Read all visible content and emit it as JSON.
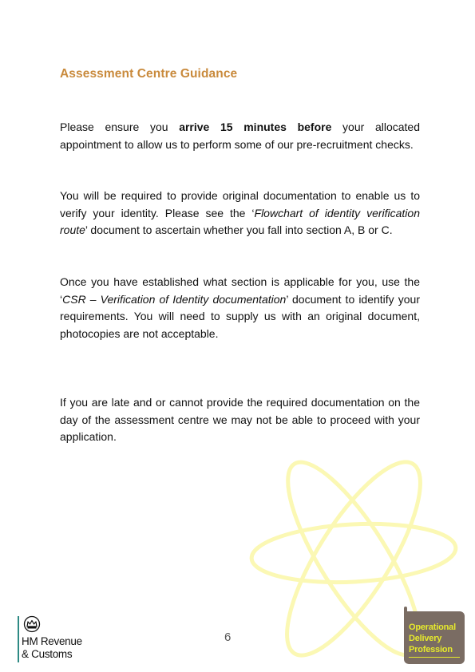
{
  "document": {
    "title": "Assessment Centre Guidance",
    "paragraphs": {
      "p1": {
        "before_bold": "Please ensure you ",
        "bold": "arrive 15 minutes before",
        "after_bold": " your allocated appointment to allow us to perform some of our pre-recruitment checks."
      },
      "p2": {
        "before_italic": "You will be required to provide original documentation to enable us to verify your identity.  Please see the ‘",
        "italic": "Flowchart of identity verification route",
        "after_italic": "’ document to ascertain whether you fall into section A, B or C."
      },
      "p3": {
        "before_italic": "Once you have established what section is applicable for you, use the ‘",
        "italic": "CSR – Verification of Identity documentation",
        "after_italic": "’ document to identify your requirements. You will need to supply us with an original document, photocopies are not acceptable."
      },
      "p4": {
        "text": "If you are late and or cannot provide the required documentation on the day of the assessment centre we may not be able to proceed with your application."
      }
    },
    "page_number": "6"
  },
  "footer": {
    "hmrc_logo": {
      "icon": "crown-crest-icon",
      "line1": "HM Revenue",
      "line2": "& Customs"
    },
    "odp_logo": {
      "line1": "Operational",
      "line2": "Delivery",
      "line3": "Profession"
    }
  },
  "colors": {
    "title": "#c98a3c",
    "atom_watermark": "#fbf8b4",
    "odp_background": "#7a6c63",
    "odp_text": "#e6ea2c",
    "hmrc_bar": "#2e8a84"
  }
}
